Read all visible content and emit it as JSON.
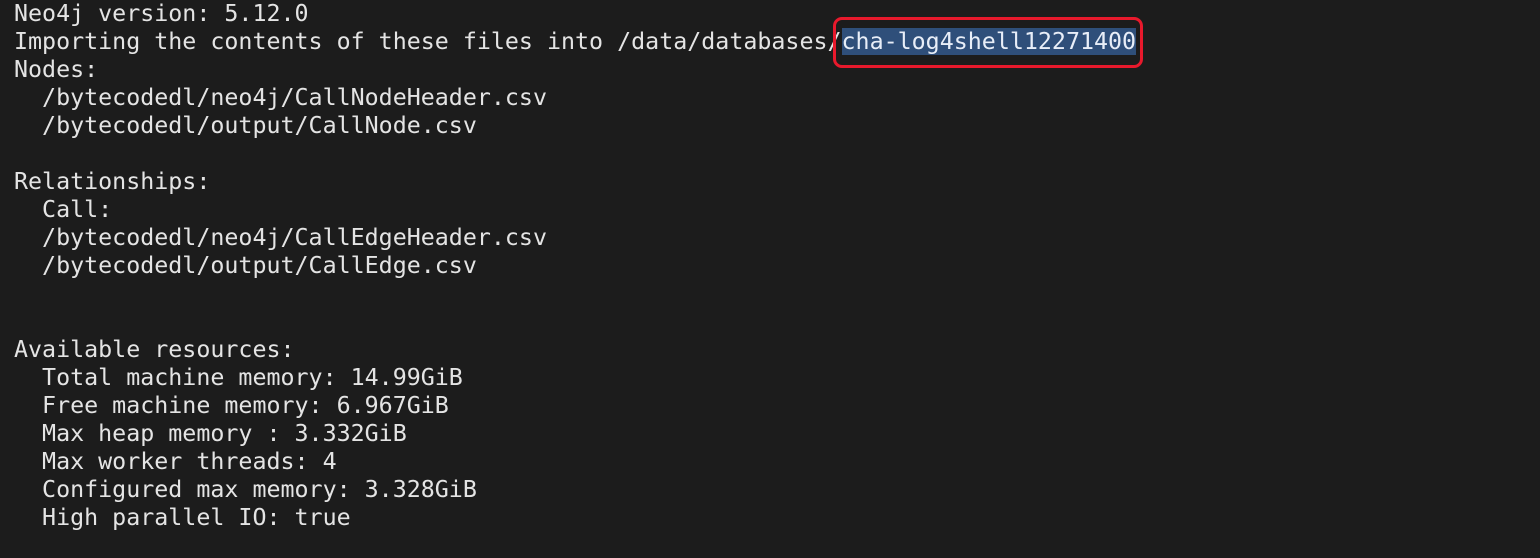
{
  "terminal": {
    "version_line": "Neo4j version: 5.12.0",
    "import_prefix": "Importing the contents of these files into /data/databases/",
    "import_target": "cha-log4shell12271400",
    "nodes_header": "Nodes:",
    "node_files": [
      "  /bytecodedl/neo4j/CallNodeHeader.csv",
      "  /bytecodedl/output/CallNode.csv"
    ],
    "relationships_header": "Relationships:",
    "call_label": "  Call:",
    "edge_files": [
      "  /bytecodedl/neo4j/CallEdgeHeader.csv",
      "  /bytecodedl/output/CallEdge.csv"
    ],
    "resources_header": "Available resources:",
    "resources": [
      "  Total machine memory: 14.99GiB",
      "  Free machine memory: 6.967GiB",
      "  Max heap memory : 3.332GiB",
      "  Max worker threads: 4",
      "  Configured max memory: 3.328GiB",
      "  High parallel IO: true"
    ]
  },
  "colors": {
    "background": "#1c1c1c",
    "text": "#e4e4e4",
    "selection": "#2f4f7a",
    "annotation_box": "#e8192c"
  }
}
